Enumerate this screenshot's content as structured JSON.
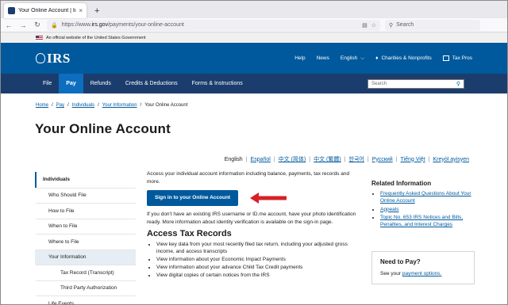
{
  "browser": {
    "tab_title": "Your Online Account | Internal R",
    "tab_close": "×",
    "new_tab": "+",
    "url_prefix": "https://www.",
    "url_domain": "irs.gov",
    "url_path": "/payments/your-online-account",
    "search_placeholder": "Search"
  },
  "gov_banner": "An official website of the United States Government",
  "header": {
    "logo": "IRS",
    "links": {
      "help": "Help",
      "news": "News",
      "language": "English",
      "charities": "Charities & Nonprofits",
      "taxpros": "Tax Pros"
    }
  },
  "mainnav": {
    "items": [
      "File",
      "Pay",
      "Refunds",
      "Credits & Deductions",
      "Forms & Instructions"
    ],
    "active": "Pay",
    "search_placeholder": "Search"
  },
  "breadcrumb": [
    "Home",
    "Pay",
    "Individuals",
    "Your Information",
    "Your Online Account"
  ],
  "page_title": "Your Online Account",
  "languages": [
    "English",
    "Español",
    "中文 (简体)",
    "中文 (繁體)",
    "한국어",
    "Русский",
    "Tiếng Việt",
    "Kreyòl ayisyen"
  ],
  "sidenav": {
    "items": [
      "Individuals",
      "Who Should File",
      "How to File",
      "When to File",
      "Where to File",
      "Your Information",
      "Tax Record (Transcript)",
      "Third Party Authorization",
      "Life Events"
    ]
  },
  "main": {
    "intro": "Access your individual account information including balance, payments, tax records and more.",
    "signin_button": "Sign in to your Online Account",
    "sub_text": "If you don't have an existing IRS username or ID.me account, have your photo identification ready. More information about identity verification is available on the sign-in page.",
    "section_title": "Access Tax Records",
    "bullets": [
      "View key data from your most recently filed tax return, including your adjusted gross income, and access transcripts",
      "View information about your Economic Impact Payments",
      "View information about your advance Child Tax Credit payments",
      "View digital copies of certain notices from the IRS"
    ]
  },
  "related": {
    "title": "Related Information",
    "links": [
      "Frequently Asked Questions About Your Online Account",
      "Appeals",
      "Topic No. 653 IRS Notices and Bills, Penalties, and Interest Charges"
    ]
  },
  "need_to_pay": {
    "title": "Need to Pay?",
    "text": "See your",
    "link": "payment options."
  },
  "colors": {
    "irs_blue": "#00599c",
    "nav_dark": "#1b3d6d",
    "arrow_red": "#d62027"
  }
}
